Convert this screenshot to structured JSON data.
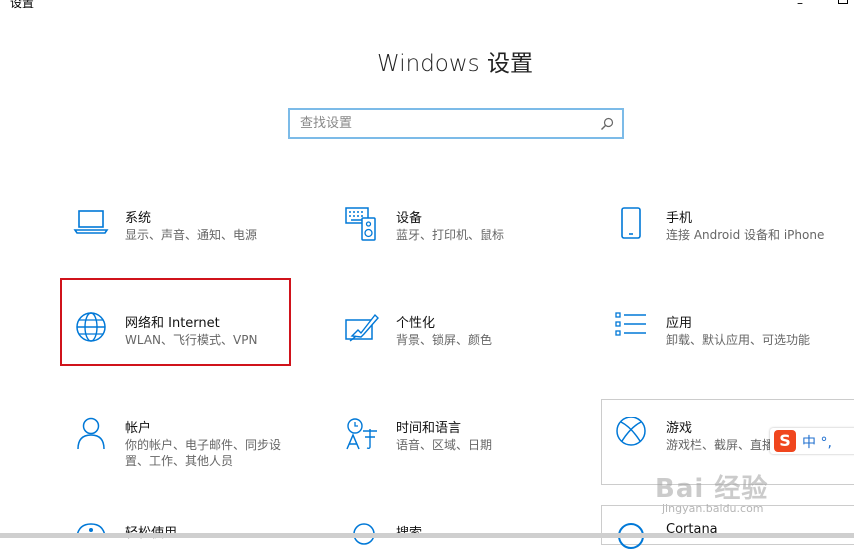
{
  "app_title": "设置",
  "window": {
    "minimize_glyph": "–"
  },
  "page_title": "Windows 设置",
  "search": {
    "value": "",
    "placeholder": "查找设置"
  },
  "tiles": [
    {
      "id": "system",
      "title": "系统",
      "subtitle": "显示、声音、通知、电源",
      "icon": "laptop-icon"
    },
    {
      "id": "devices",
      "title": "设备",
      "subtitle": "蓝牙、打印机、鼠标",
      "icon": "keyboard-speaker-icon"
    },
    {
      "id": "phone",
      "title": "手机",
      "subtitle": "连接 Android 设备和 iPhone",
      "icon": "phone-icon"
    },
    {
      "id": "network",
      "title": "网络和 Internet",
      "subtitle": "WLAN、飞行模式、VPN",
      "icon": "globe-icon"
    },
    {
      "id": "personalization",
      "title": "个性化",
      "subtitle": "背景、锁屏、颜色",
      "icon": "paint-icon"
    },
    {
      "id": "apps",
      "title": "应用",
      "subtitle": "卸载、默认应用、可选功能",
      "icon": "apps-list-icon"
    },
    {
      "id": "accounts",
      "title": "帐户",
      "subtitle_lines": [
        "你的帐户、电子邮件、同步设",
        "置、工作、其他人员"
      ],
      "icon": "person-icon"
    },
    {
      "id": "time-language",
      "title": "时间和语言",
      "subtitle": "语音、区域、日期",
      "icon": "time-language-icon"
    },
    {
      "id": "gaming",
      "title": "游戏",
      "subtitle": "游戏栏、截屏、直播",
      "icon": "xbox-icon"
    },
    {
      "id": "ease-of-access",
      "title": "轻松使用",
      "icon": "ease-of-access-icon"
    },
    {
      "id": "search",
      "title": "搜索",
      "icon": "search-icon"
    },
    {
      "id": "cortana",
      "title": "Cortana",
      "icon": "cortana-icon"
    }
  ],
  "ime": {
    "logo": "S",
    "text": "中 °,"
  },
  "watermark": {
    "main": "Bai 经验",
    "sub": "jingyan.baidu.com"
  },
  "colors": {
    "accent": "#0078d7",
    "highlight_border": "#d0131b",
    "search_border": "#7cbbe8"
  }
}
